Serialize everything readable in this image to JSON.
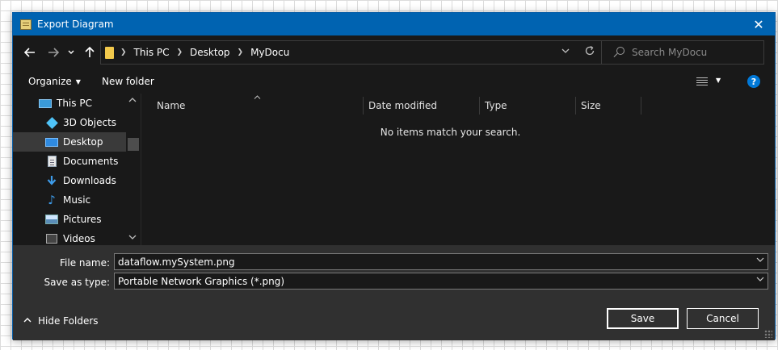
{
  "window": {
    "title": "Export Diagram",
    "close_glyph": "✕"
  },
  "nav": {
    "back_icon": "back-arrow-icon",
    "forward_icon": "forward-arrow-icon",
    "recent_icon": "chevron-down-icon",
    "up_icon": "up-arrow-icon",
    "breadcrumbs": [
      "This PC",
      "Desktop",
      "MyDocu"
    ],
    "search_placeholder": "Search MyDocu"
  },
  "toolbar": {
    "organize_label": "Organize",
    "new_folder_label": "New folder",
    "help_label": "?"
  },
  "sidebar": {
    "items": [
      {
        "label": "This PC",
        "icon": "computer-icon"
      },
      {
        "label": "3D Objects",
        "icon": "cube-icon"
      },
      {
        "label": "Desktop",
        "icon": "desktop-icon",
        "selected": true
      },
      {
        "label": "Documents",
        "icon": "document-icon"
      },
      {
        "label": "Downloads",
        "icon": "download-icon"
      },
      {
        "label": "Music",
        "icon": "music-icon"
      },
      {
        "label": "Pictures",
        "icon": "picture-icon"
      },
      {
        "label": "Videos",
        "icon": "video-icon"
      }
    ]
  },
  "filelist": {
    "columns": [
      "Name",
      "Date modified",
      "Type",
      "Size"
    ],
    "empty_message": "No items match your search."
  },
  "form": {
    "filename_label": "File name:",
    "filename_value": "dataflow.mySystem.png",
    "type_label": "Save as type:",
    "type_value": "Portable Network Graphics (*.png)"
  },
  "footer": {
    "hide_folders_label": "Hide Folders",
    "save_label": "Save",
    "cancel_label": "Cancel"
  },
  "colors": {
    "titlebar": "#0063b1",
    "accent": "#0078d7",
    "background": "#191919"
  }
}
